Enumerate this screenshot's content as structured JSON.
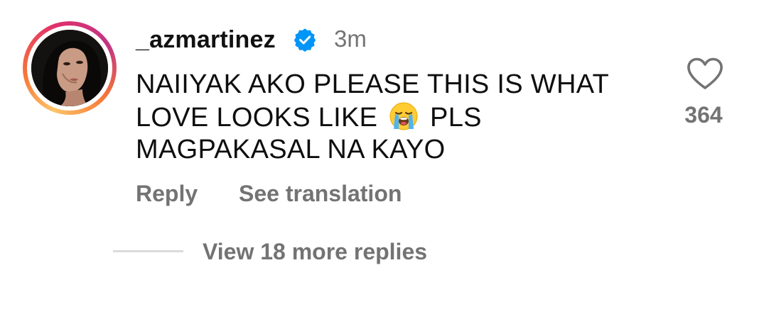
{
  "comment": {
    "username": "_azmartinez",
    "verified": true,
    "timestamp": "3m",
    "text_line1": "NAIIYAK AKO PLEASE THIS IS WHAT",
    "text_line2_before_emoji": "LOVE LOOKS LIKE",
    "text_line2_after_emoji": "PLS",
    "text_line3": "MAGPAKASAL NA KAYO",
    "emoji": "loudly-crying-face"
  },
  "actions": {
    "reply_label": "Reply",
    "see_translation_label": "See translation"
  },
  "likes": {
    "count": "364",
    "icon": "heart-outline-icon"
  },
  "replies": {
    "view_label": "View 18 more replies"
  },
  "colors": {
    "verified_blue": "#0095f6",
    "secondary_text": "#737373",
    "primary_text": "#0e0e0e",
    "ring_gradient": [
      "#fdc468",
      "#f77737",
      "#e1306c",
      "#c13584"
    ]
  }
}
